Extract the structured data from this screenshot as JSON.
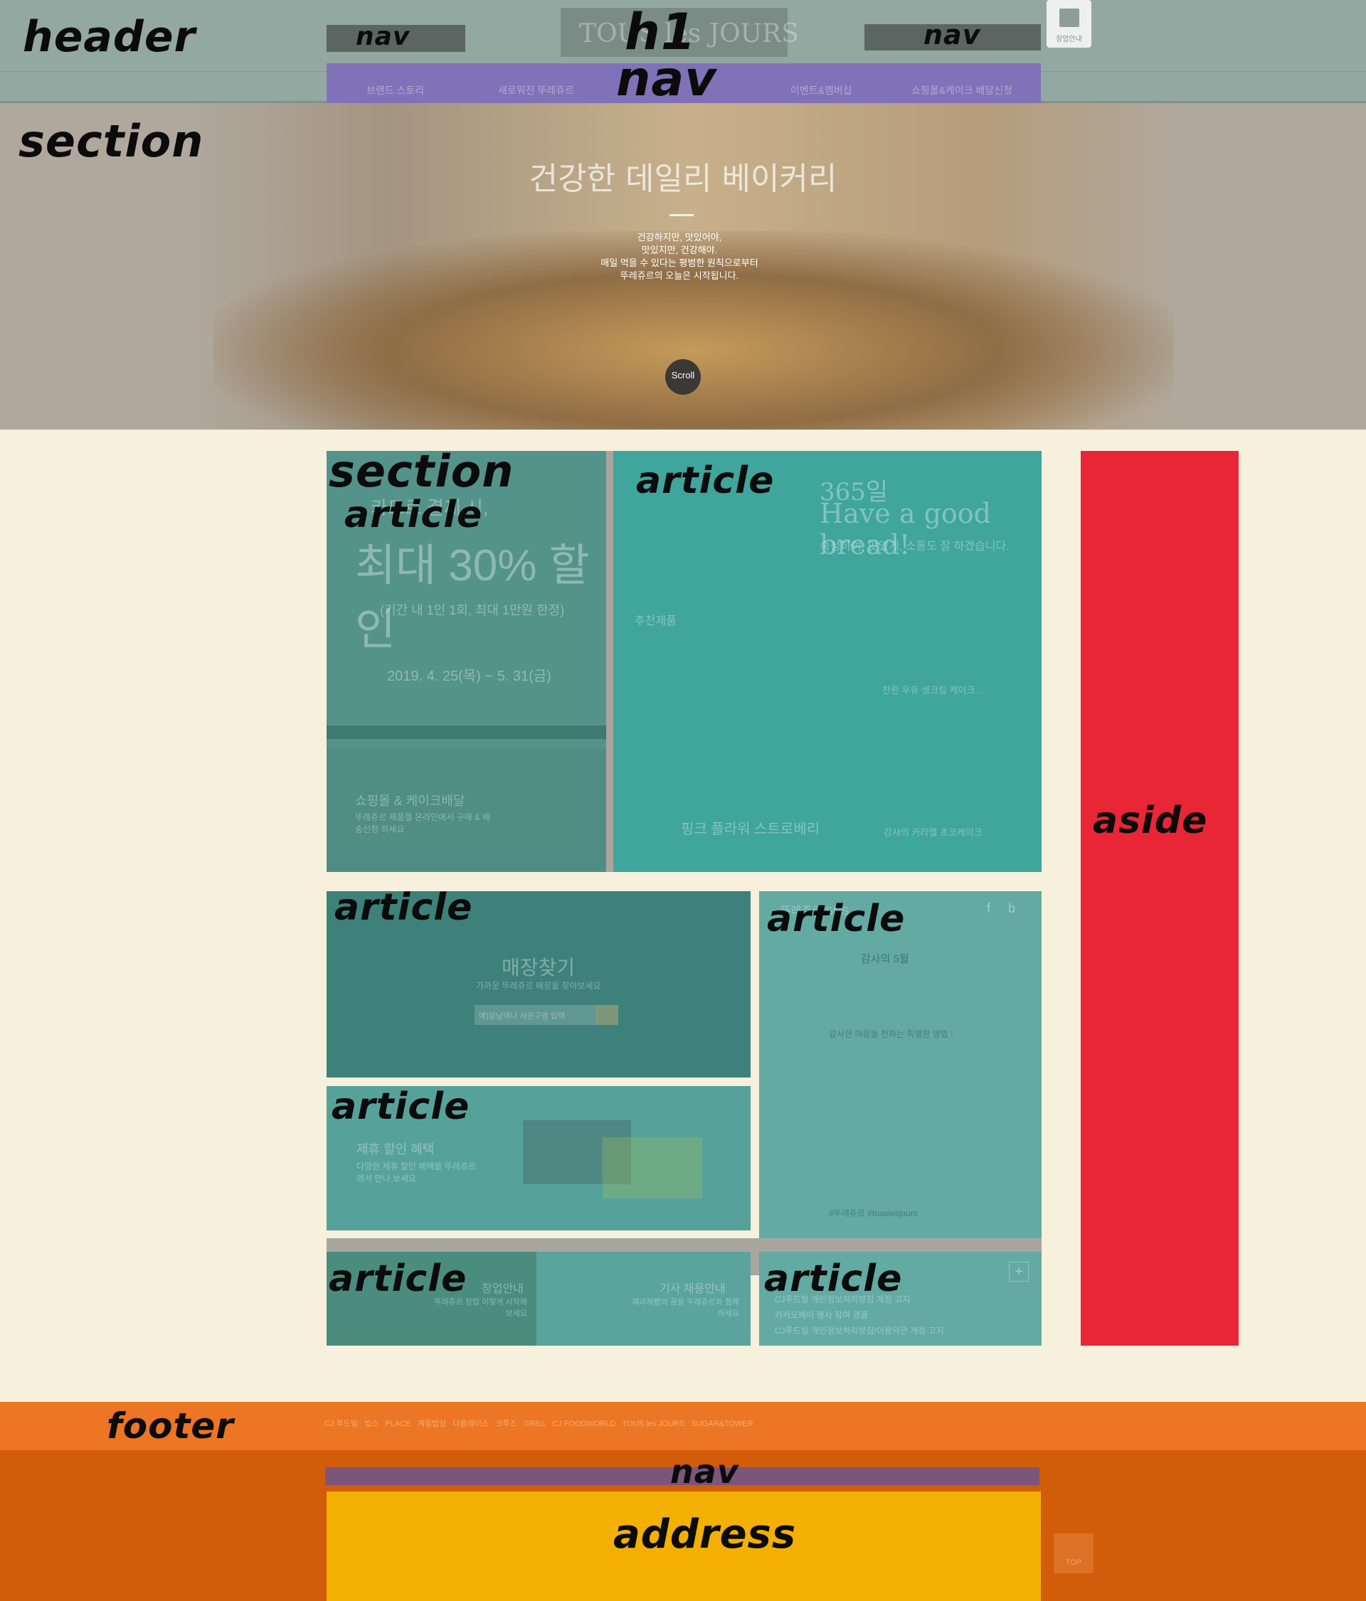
{
  "labels": {
    "header": "header",
    "social_nav": "nav",
    "logo": "h1",
    "util_nav": "nav",
    "gnb": "nav",
    "hero_section": "section",
    "main_section": "section",
    "promo_article": "article",
    "recommend_article": "article",
    "store_article": "article",
    "sns_article": "article",
    "partner_article": "article",
    "job_article": "article",
    "notice_article": "article",
    "aside": "aside",
    "footer": "footer",
    "footer_nav": "nav",
    "address": "address"
  },
  "header": {
    "logo_text": "TOUS les JOURS",
    "franchise_label": "창업안내",
    "gnb_items": [
      "브랜드 스토리",
      "새로워진 뚜레쥬르",
      "",
      "이벤트&멤버십",
      "쇼핑몰&케이크 배달신청"
    ]
  },
  "hero": {
    "title": "건강한 데일리 베이커리",
    "lines": [
      "건강하지만, 맛있어야,",
      "맛있지만, 건강해야.",
      "매일 먹을 수 있다는 평범한 원칙으로부터",
      "뚜레쥬르의 오늘은 시작됩니다."
    ],
    "scroll_label": "Scroll"
  },
  "promo": {
    "headline": "카드로 결제 시,",
    "big": "최대 30% 할인",
    "sub": "(기간 내 1인 1회, 최대 1만원 한정)",
    "period": "2019. 4. 25(목) ~ 5. 31(금)"
  },
  "shop": {
    "title": "쇼핑몰 & 케이크배달",
    "desc": "뚜레쥬르 제품을 온라인에서 구매 & 배송신청 하세요"
  },
  "recommend": {
    "slogan_1": "365일",
    "slogan_2": "Have a good bread!",
    "slogan_3": "숙성하여, 맛있게, 소통도 잘 하겠습니다.",
    "section_title": "추천제품",
    "products": [
      "핑크 플라워 스트로베리",
      "찬란 우유 생크림 케이크 ...",
      "감사의 카라멜 초코케이크"
    ]
  },
  "store": {
    "title": "매장찾기",
    "sub": "가까운 뚜레쥬르 매장을 찾아보세요",
    "placeholder": "예)강남역나 사관구명 입력"
  },
  "sns": {
    "title": "뚜레쥬르 SNS",
    "post_title": "감사의 5월",
    "lines": [
      "감사한 마음을 전하는 특별한 방법 !",
      "#뚜레쥬르 #touslesjours"
    ]
  },
  "partner": {
    "title": "제휴 할인 혜택",
    "desc": "다양한 제휴 할인 혜택을 뚜레쥬르에서 만나 보세요"
  },
  "job": {
    "left_title": "창업안내",
    "left_desc": "뚜레쥬르 창업 이렇게 시작해 보세요",
    "right_title": "기사 채용안내",
    "right_desc": "제과제빵의 꿈을 뚜레쥬르와 함께 하세요"
  },
  "notice": {
    "items": [
      "CJ푸드빌 개인정보처리방침 개정 고지",
      "카카오페이 행사 참여 경품",
      "CJ푸드빌 개인정보처리방침/이용약관 개정 고지"
    ]
  },
  "family_brands": [
    "CJ 푸드빌",
    "빕스",
    "PLACE",
    "계절밥상",
    "더플레이스",
    "크루즈",
    "GRILL",
    "CJ FOODWORLD",
    "TOUS les JOURS",
    "SUGAR&TOWER"
  ],
  "top_label": "TOP",
  "colors": {
    "header": "#93a8a0",
    "gnb": "#8072b8",
    "article": "#3fa59d",
    "aside": "#e92635",
    "footer": "#d15c0a",
    "family": "#ec7624",
    "address": "#f3b003",
    "footer_nav": "#7b557a",
    "page_bg": "#f7f0dd"
  }
}
